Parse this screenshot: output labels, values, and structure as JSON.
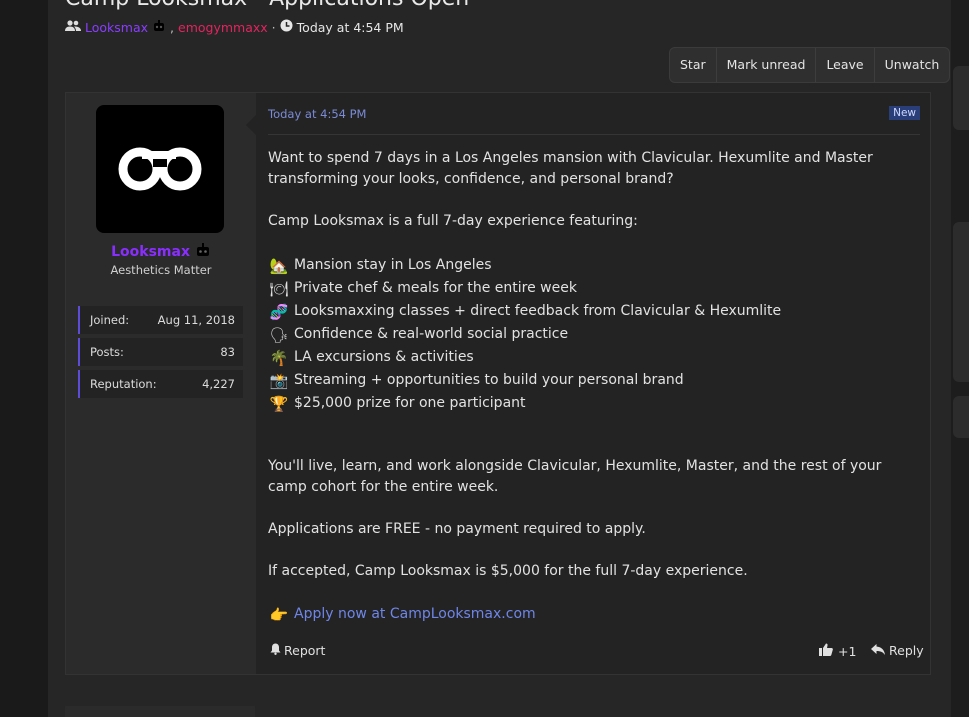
{
  "thread": {
    "title": "Camp Looksmax - Applications Open",
    "author1": "Looksmax",
    "author2": "emogymmaxx",
    "separator1": ",",
    "separator2": "·",
    "time": "Today at 4:54 PM"
  },
  "toolbar": {
    "star": "Star",
    "mark_unread": "Mark unread",
    "leave": "Leave",
    "unwatch": "Unwatch"
  },
  "user": {
    "name": "Looksmax",
    "title": "Aesthetics Matter",
    "stats": [
      {
        "label": "Joined:",
        "value": "Aug 11, 2018"
      },
      {
        "label": "Posts:",
        "value": "83"
      },
      {
        "label": "Reputation:",
        "value": "4,227"
      }
    ]
  },
  "post": {
    "time": "Today at 4:54 PM",
    "badge": "New",
    "intro": "Want to spend 7 days in a Los Angeles mansion with Clavicular. Hexumlite and Master transforming your looks, confidence, and personal brand?",
    "features_intro": "Camp Looksmax is a full 7-day experience featuring:",
    "features": [
      {
        "icon": "house-icon",
        "emoji": "🏡",
        "text": "Mansion stay in Los Angeles"
      },
      {
        "icon": "chef-icon",
        "emoji": "🍽",
        "text": "Private chef & meals for the entire week"
      },
      {
        "icon": "dna-icon",
        "emoji": "🧬",
        "text": "Looksmaxxing classes + direct feedback from Clavicular & Hexumlite"
      },
      {
        "icon": "speaking-head-icon",
        "emoji": "🗣",
        "text": "Confidence & real-world social practice"
      },
      {
        "icon": "palm-tree-icon",
        "emoji": "🌴",
        "text": "LA excursions & activities"
      },
      {
        "icon": "camera-flash-icon",
        "emoji": "📸",
        "text": "Streaming + opportunities to build your personal brand"
      },
      {
        "icon": "trophy-icon",
        "emoji": "🏆",
        "text": "$25,000 prize for one participant"
      }
    ],
    "cohort": "You'll live, learn, and work alongside Clavicular, Hexumlite, Master, and the rest of your camp cohort for the entire week.",
    "free": "Applications are FREE - no payment required to apply.",
    "price": "If accepted, Camp Looksmax is $5,000 for the full 7-day experience.",
    "apply_emoji": "👉",
    "apply_link": "Apply now at CampLooksmax.com"
  },
  "footer": {
    "report": "Report",
    "like_count": "+1",
    "reply": "Reply"
  },
  "colors": {
    "accent": "#8a2eff",
    "author2": "#e2245f",
    "link": "#6f86e8"
  }
}
